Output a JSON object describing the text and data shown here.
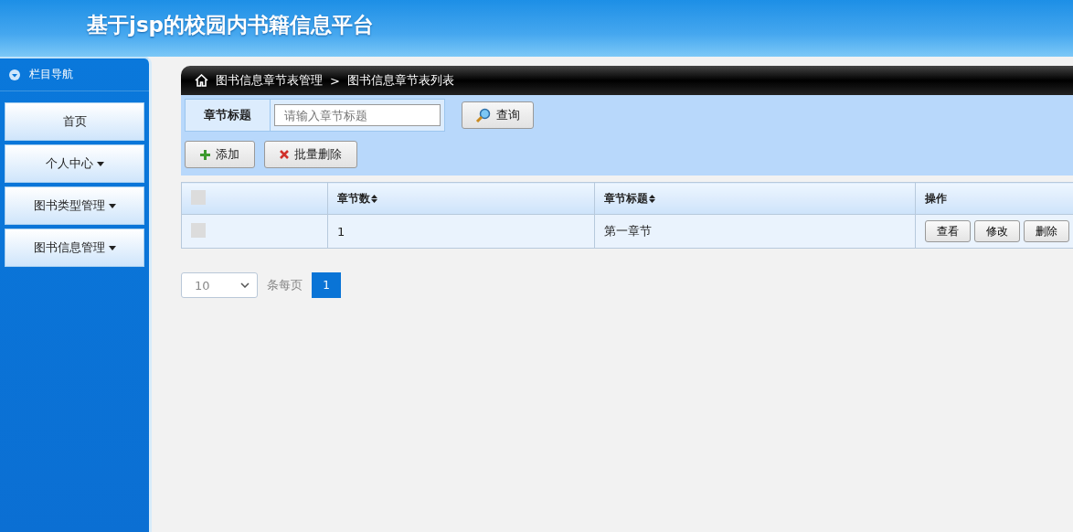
{
  "header": {
    "title": "基于jsp的校园内书籍信息平台"
  },
  "sidebar": {
    "heading": "栏目导航",
    "items": [
      {
        "label": "首页",
        "dropdown": false
      },
      {
        "label": "个人中心",
        "dropdown": true
      },
      {
        "label": "图书类型管理",
        "dropdown": true
      },
      {
        "label": "图书信息管理",
        "dropdown": true
      }
    ]
  },
  "breadcrumb": {
    "section": "图书信息章节表管理",
    "separator": ">",
    "page": "图书信息章节表列表"
  },
  "search": {
    "label": "章节标题",
    "placeholder": "请输入章节标题",
    "button": "查询"
  },
  "actions": [
    {
      "kind": "add",
      "label": "添加"
    },
    {
      "kind": "delete",
      "label": "批量删除"
    }
  ],
  "table": {
    "header_checkbox": {
      "checked": false
    },
    "columns": [
      {
        "label": "章节数",
        "sortable": true
      },
      {
        "label": "章节标题",
        "sortable": true
      },
      {
        "label": "操作",
        "sortable": false
      }
    ],
    "rows": [
      {
        "checked": false,
        "cells": [
          "1",
          "第一章节"
        ],
        "buttons": [
          "查看",
          "修改",
          "删除"
        ]
      }
    ]
  },
  "pagination": {
    "page_size": "10",
    "per_page_label": "条每页",
    "pages": [
      {
        "label": "1",
        "selected": true
      }
    ]
  }
}
